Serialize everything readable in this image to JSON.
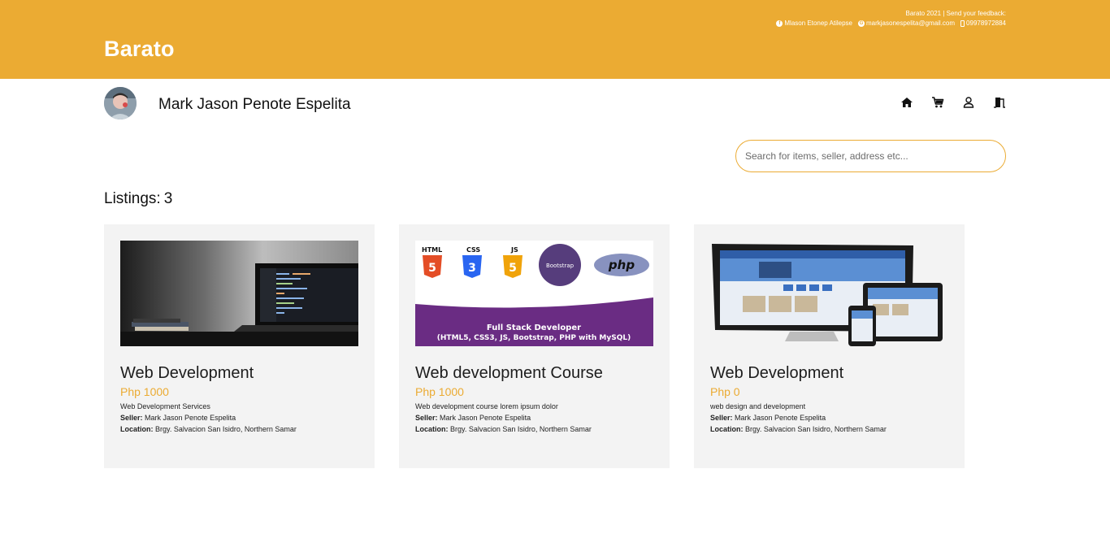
{
  "header": {
    "brand": "Barato",
    "feedback_line": "Barato 2021 | Send your feedback:",
    "facebook": "Mlason Etonep Atilepse",
    "email": "markjasonespelita@gmail.com",
    "phone": "09978972884"
  },
  "profile": {
    "name": "Mark Jason Penote Espelita"
  },
  "nav": {
    "icons": [
      "home-icon",
      "cart-icon",
      "user-icon",
      "logout-icon"
    ]
  },
  "search": {
    "placeholder": "Search for items, seller, address etc..."
  },
  "listings": {
    "label": "Listings:",
    "count": "3",
    "items": [
      {
        "title": "Web Development",
        "price": "Php 1000",
        "description": "Web Development Services",
        "seller_label": "Seller:",
        "seller": "Mark Jason Penote Espelita",
        "location_label": "Location:",
        "location": "Brgy. Salvacion San Isidro, Northern Samar"
      },
      {
        "title": "Web development Course",
        "price": "Php 1000",
        "description": "Web development course lorem ipsum dolor",
        "seller_label": "Seller:",
        "seller": "Mark Jason Penote Espelita",
        "location_label": "Location:",
        "location": "Brgy. Salvacion San Isidro, Northern Samar",
        "image_text": {
          "html": "HTML",
          "css": "CSS",
          "js": "JS",
          "bootstrap": "Bootstrap",
          "php": "php",
          "banner_line1": "Full Stack Developer",
          "banner_line2": "(HTML5, CSS3, JS, Bootstrap, PHP with MySQL)"
        }
      },
      {
        "title": "Web Development",
        "price": "Php 0",
        "description": "web design and development",
        "seller_label": "Seller:",
        "seller": "Mark Jason Penote Espelita",
        "location_label": "Location:",
        "location": "Brgy. Salvacion San Isidro, Northern Samar"
      }
    ]
  },
  "colors": {
    "accent": "#ebab33",
    "card_bg": "#f3f3f3"
  }
}
